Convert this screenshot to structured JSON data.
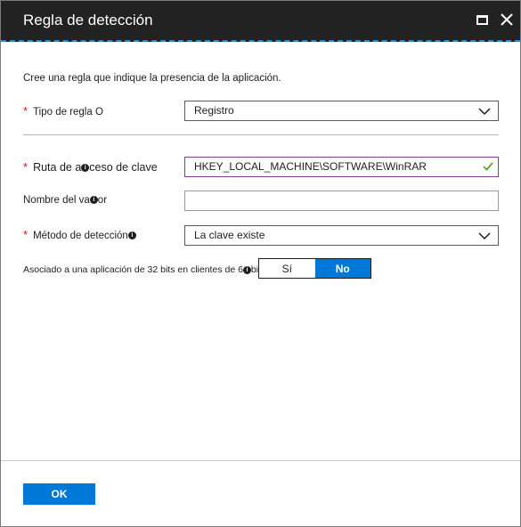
{
  "window": {
    "title": "Regla de detección"
  },
  "intro": "Cree una regla que indique la presencia de la aplicación.",
  "form": {
    "rule_type": {
      "required_mark": "*",
      "label": "Tipo de regla",
      "label_suffix": "O",
      "value": "Registro"
    },
    "key_path": {
      "required_mark": "*",
      "label_part1": "Ruta de a",
      "label_part2": "ceso de clave",
      "value": "HKEY_LOCAL_MACHINE\\SOFTWARE\\WinRAR"
    },
    "value_name": {
      "label_part1": "Nombre del va",
      "label_part2": "or",
      "value": ""
    },
    "detection_method": {
      "required_mark": "*",
      "label": "Método de detección",
      "value": "La clave existe"
    },
    "app_32bit": {
      "label_part1": "Asociado a una aplicación de 32 bits en clientes de 6",
      "label_part2": "bits",
      "options": [
        "Sí",
        "No"
      ],
      "selected": "No"
    }
  },
  "footer": {
    "ok_label": "OK"
  },
  "colors": {
    "titlebar": "#222222",
    "accent": "#0078d7",
    "required": "#c41c1c",
    "focus_border": "#7b3f8f",
    "valid_check": "#5ba829"
  },
  "icons": {
    "maximize": "maximize-icon",
    "close": "close-icon",
    "dropdown": "chevron-down-icon",
    "info": "info-icon",
    "valid": "checkmark-icon"
  }
}
